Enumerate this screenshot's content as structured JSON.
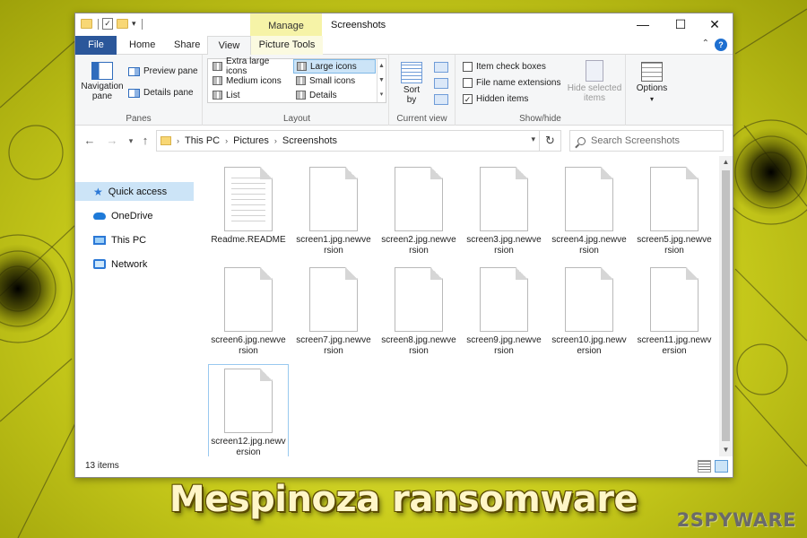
{
  "titlebar": {
    "context_tab": "Manage",
    "title": "Screenshots",
    "minimize_icon": "minimize-icon",
    "maximize_icon": "maximize-icon",
    "close_icon": "close-icon"
  },
  "tabs": {
    "file": "File",
    "home": "Home",
    "share": "Share",
    "view": "View",
    "picture_tools": "Picture Tools"
  },
  "ribbon": {
    "panes": {
      "label": "Panes",
      "navigation_pane": "Navigation pane",
      "preview_pane": "Preview pane",
      "details_pane": "Details pane"
    },
    "layout": {
      "label": "Layout",
      "options": [
        "Extra large icons",
        "Large icons",
        "Medium icons",
        "Small icons",
        "List",
        "Details"
      ],
      "selected": "Large icons"
    },
    "current_view": {
      "label": "Current view",
      "sort_by": "Sort by"
    },
    "show_hide": {
      "label": "Show/hide",
      "item_check_boxes": "Item check boxes",
      "file_name_extensions": "File name extensions",
      "hidden_items": "Hidden items",
      "item_check_boxes_checked": false,
      "file_name_extensions_checked": false,
      "hidden_items_checked": true,
      "hide_selected_items": "Hide selected items"
    },
    "options": "Options"
  },
  "address": {
    "path": [
      "This PC",
      "Pictures",
      "Screenshots"
    ],
    "search_placeholder": "Search Screenshots"
  },
  "nav_pane": {
    "items": [
      {
        "label": "Quick access",
        "icon": "star-icon",
        "selected": true
      },
      {
        "label": "OneDrive",
        "icon": "cloud-icon",
        "selected": false
      },
      {
        "label": "This PC",
        "icon": "computer-icon",
        "selected": false
      },
      {
        "label": "Network",
        "icon": "network-icon",
        "selected": false
      }
    ]
  },
  "files": [
    {
      "name": "Readme.README",
      "type": "text"
    },
    {
      "name": "screen1.jpg.newversion",
      "type": "blank"
    },
    {
      "name": "screen2.jpg.newversion",
      "type": "blank"
    },
    {
      "name": "screen3.jpg.newversion",
      "type": "blank"
    },
    {
      "name": "screen4.jpg.newversion",
      "type": "blank"
    },
    {
      "name": "screen5.jpg.newversion",
      "type": "blank"
    },
    {
      "name": "screen6.jpg.newversion",
      "type": "blank"
    },
    {
      "name": "screen7.jpg.newversion",
      "type": "blank"
    },
    {
      "name": "screen8.jpg.newversion",
      "type": "blank"
    },
    {
      "name": "screen9.jpg.newversion",
      "type": "blank"
    },
    {
      "name": "screen10.jpg.newversion",
      "type": "blank"
    },
    {
      "name": "screen11.jpg.newversion",
      "type": "blank"
    },
    {
      "name": "screen12.jpg.newversion",
      "type": "blank"
    }
  ],
  "status": {
    "item_count": "13 items"
  },
  "caption": "Mespinoza ransomware",
  "logo": "2SPYWARE",
  "colors": {
    "background": "#d4d62a",
    "file_tab": "#2b579a",
    "manage_tab": "#f6f3a7",
    "selection": "#cce4f7",
    "caption_text": "#fff6c8"
  }
}
